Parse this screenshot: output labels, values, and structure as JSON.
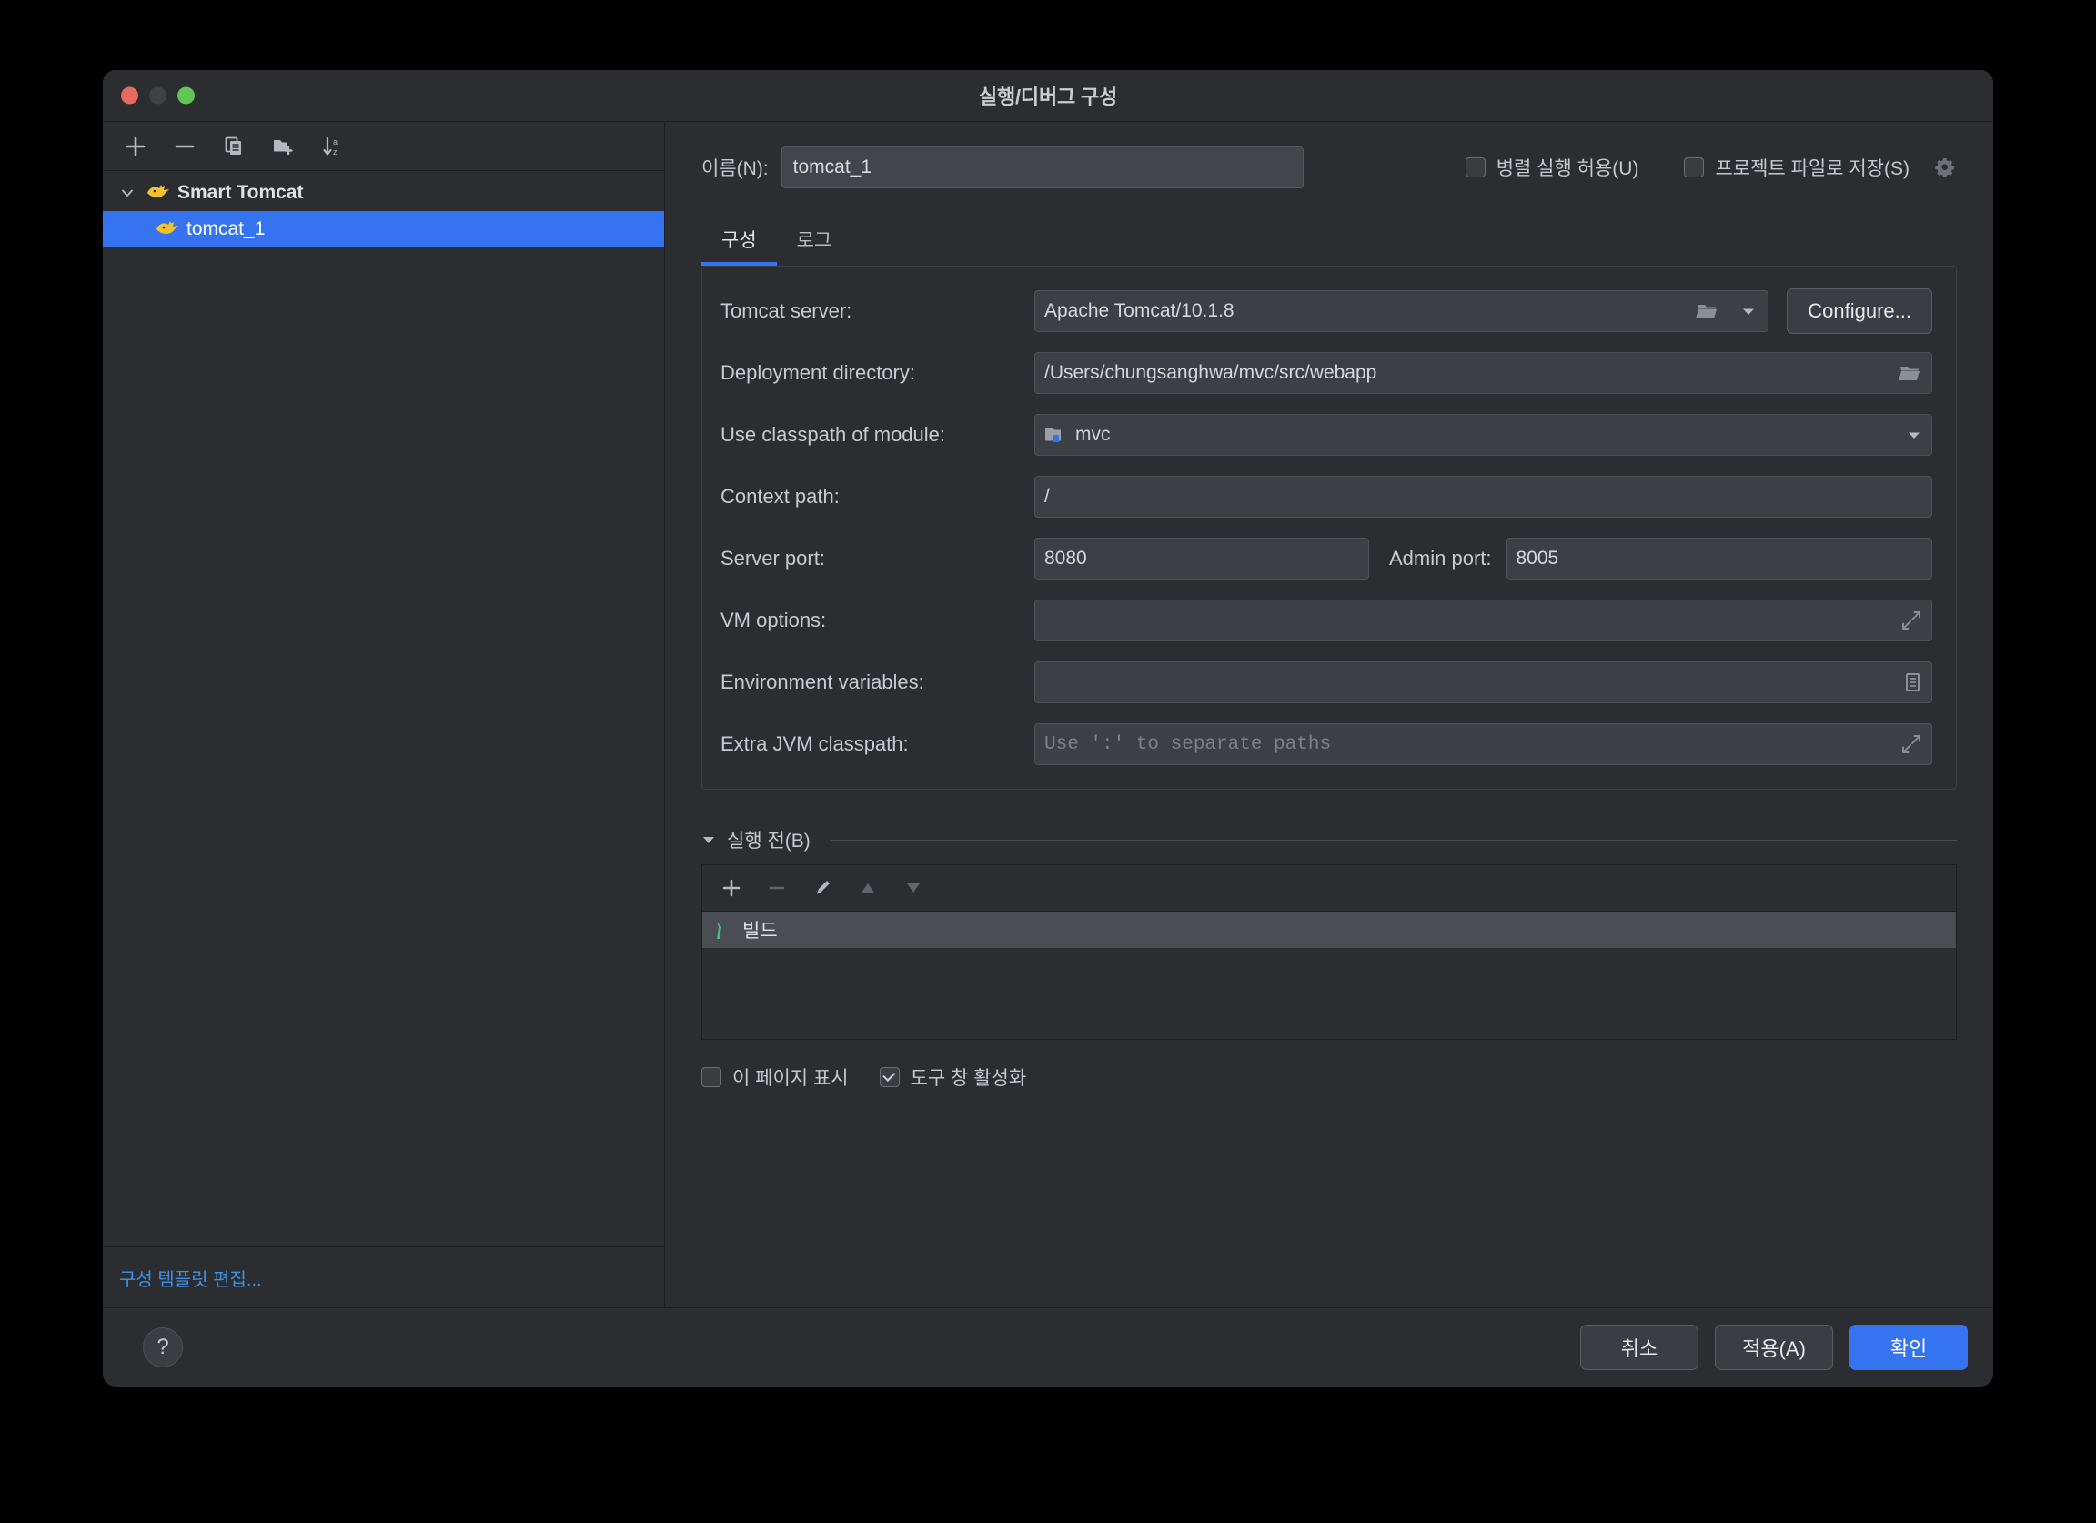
{
  "window": {
    "title": "실행/디버그 구성",
    "traffic": [
      "close-red",
      "minimize-yellow",
      "zoom-green"
    ]
  },
  "sidebar": {
    "toolbar": [
      {
        "name": "add-configuration-button",
        "icon": "plus-icon"
      },
      {
        "name": "remove-configuration-button",
        "icon": "minus-icon"
      },
      {
        "name": "copy-configuration-button",
        "icon": "copy-icon"
      },
      {
        "name": "new-folder-button",
        "icon": "folder-add-icon"
      },
      {
        "name": "sort-configurations-button",
        "icon": "sort-az-icon"
      }
    ],
    "tree": [
      {
        "label": "Smart Tomcat",
        "type": "group",
        "expanded": true,
        "icon": "tomcat-icon"
      },
      {
        "label": "tomcat_1",
        "type": "item",
        "selected": true,
        "icon": "tomcat-icon"
      }
    ],
    "edit_templates_link": "구성 템플릿 편집..."
  },
  "header": {
    "name_label": "이름(N):",
    "name_value": "tomcat_1",
    "allow_parallel_run": {
      "label": "병렬 실행 허용(U)",
      "checked": false
    },
    "store_as_project_file": {
      "label": "프로젝트 파일로 저장(S)",
      "checked": false
    },
    "gear_icon": "gear-dropdown-icon"
  },
  "tabs": [
    {
      "label": "구성",
      "active": true
    },
    {
      "label": "로그",
      "active": false
    }
  ],
  "config": {
    "tomcat_server": {
      "label": "Tomcat server:",
      "value": "Apache Tomcat/10.1.8",
      "browse_icon": "folder-icon",
      "dropdown_icon": "chevron-down-icon",
      "configure_button": "Configure..."
    },
    "deployment_directory": {
      "label": "Deployment directory:",
      "value": "/Users/chungsanghwa/mvc/src/webapp",
      "browse_icon": "folder-icon"
    },
    "use_classpath_of_module": {
      "label": "Use classpath of module:",
      "value": "mvc",
      "module_icon": "module-icon",
      "dropdown_icon": "chevron-down-icon"
    },
    "context_path": {
      "label": "Context path:",
      "value": "/"
    },
    "server_port": {
      "label": "Server port:",
      "value": "8080"
    },
    "admin_port": {
      "label": "Admin port:",
      "value": "8005"
    },
    "vm_options": {
      "label": "VM options:",
      "value": "",
      "expand_icon": "expand-icon"
    },
    "environment_variables": {
      "label": "Environment variables:",
      "value": "",
      "browse_icon": "env-list-icon"
    },
    "extra_jvm_classpath": {
      "label": "Extra JVM classpath:",
      "value": "",
      "placeholder": "Use ':' to separate paths",
      "expand_icon": "expand-icon"
    }
  },
  "before_launch": {
    "title": "실행 전(B)",
    "caret_icon": "caret-down-icon",
    "toolbar": [
      {
        "name": "add-task-button",
        "icon": "plus-icon",
        "enabled": true
      },
      {
        "name": "remove-task-button",
        "icon": "minus-icon",
        "enabled": false
      },
      {
        "name": "edit-task-button",
        "icon": "pencil-icon",
        "enabled": true
      },
      {
        "name": "move-task-up-button",
        "icon": "arrow-up-icon",
        "enabled": false
      },
      {
        "name": "move-task-down-button",
        "icon": "arrow-down-icon",
        "enabled": false
      }
    ],
    "tasks": [
      {
        "label": "빌드",
        "icon": "build-hammer-icon",
        "selected": true
      }
    ],
    "show_this_page": {
      "label": "이 페이지 표시",
      "checked": false
    },
    "activate_tool_window": {
      "label": "도구 창 활성화",
      "checked": true
    }
  },
  "footer": {
    "help_label": "?",
    "cancel_label": "취소",
    "apply_label": "적용(A)",
    "ok_label": "확인"
  },
  "colors": {
    "accent": "#3573f0",
    "link": "#3d93e8",
    "selection": "#3573f0",
    "build_icon_green": "#3cc57f",
    "window_bg": "#2b2d30",
    "field_bg": "#3c3f43"
  }
}
